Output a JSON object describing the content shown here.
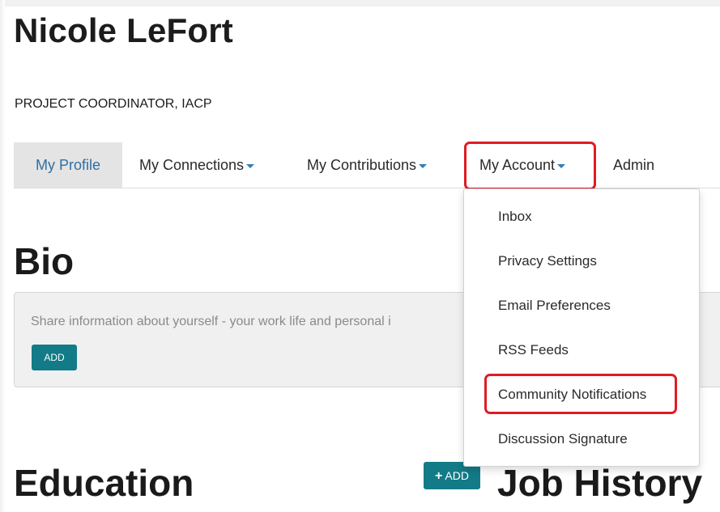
{
  "profile": {
    "name": "Nicole LeFort",
    "title": "PROJECT COORDINATOR, IACP"
  },
  "nav": {
    "items": [
      {
        "label": "My Profile"
      },
      {
        "label": "My Connections"
      },
      {
        "label": "My Contributions"
      },
      {
        "label": "My Account"
      },
      {
        "label": "Admin"
      }
    ]
  },
  "dropdown": {
    "items": [
      {
        "label": "Inbox"
      },
      {
        "label": "Privacy Settings"
      },
      {
        "label": "Email Preferences"
      },
      {
        "label": "RSS Feeds"
      },
      {
        "label": "Community Notifications"
      },
      {
        "label": "Discussion Signature"
      }
    ]
  },
  "bio": {
    "heading": "Bio",
    "text": "Share information about yourself - your work life and personal i",
    "add_label": "ADD"
  },
  "education": {
    "heading": "Education",
    "add_label": "ADD"
  },
  "job_history": {
    "heading": "Job History"
  },
  "colors": {
    "accent": "#127b87",
    "highlight": "#e01b24",
    "active_link": "#2f6fa3"
  },
  "icons": [
    "caret-down-icon",
    "plus-icon"
  ]
}
